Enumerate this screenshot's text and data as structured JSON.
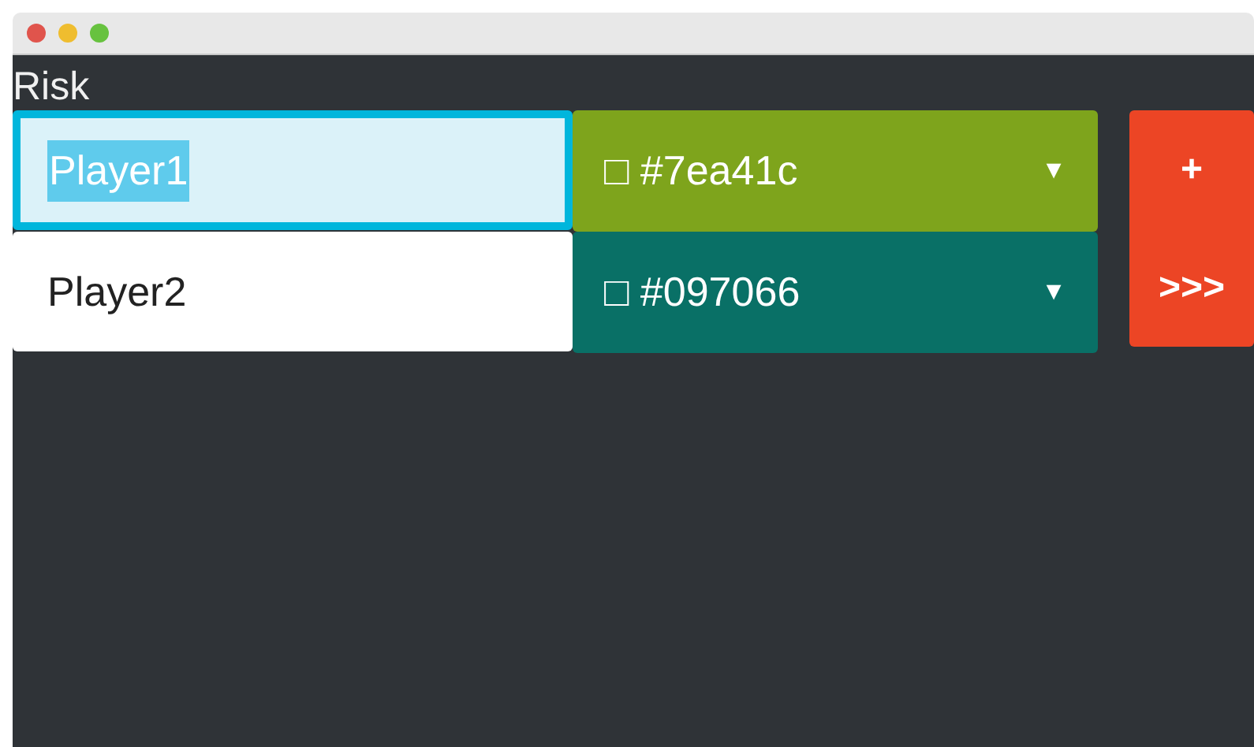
{
  "window": {
    "title": "Risk"
  },
  "players": [
    {
      "name": "Player1",
      "focused": true,
      "color": "#7ea41c",
      "color_label": "□ #7ea41c",
      "caret": "▼"
    },
    {
      "name": "Player2",
      "focused": false,
      "color": "#097066",
      "color_label": "□ #097066",
      "caret": "▼"
    }
  ],
  "buttons": [
    {
      "label": "+"
    },
    {
      "label": ">>>"
    }
  ]
}
